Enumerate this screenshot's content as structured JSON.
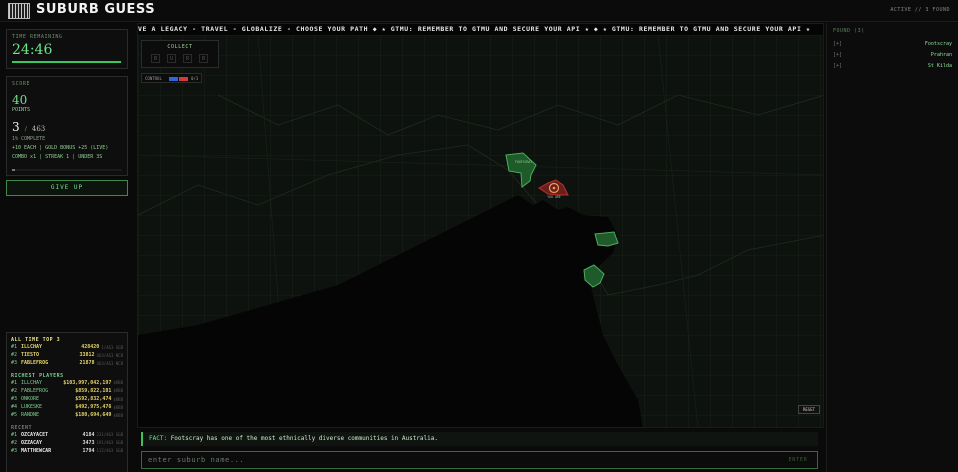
{
  "header": {
    "title": "SUBURB GUESS",
    "status": "ACTIVE // 3 FOUND"
  },
  "timer": {
    "label": "TIME REMAINING",
    "value": "24:46",
    "progress": 0.99
  },
  "score": {
    "label": "SCORE",
    "points": "40",
    "points_label": "POINTS",
    "found": "3",
    "separator": "/",
    "total": "463",
    "complete": "1% COMPLETE",
    "bonus": "+10 EACH | GOLD BONUS +25 (LIVE)",
    "combo": "COMBO x1 | STREAK 1 | UNDER 3S",
    "progress": 0.01
  },
  "give_up_label": "GIVE UP",
  "leaderboards": {
    "all_time": {
      "title": "ALL TIME TOP 3",
      "rows": [
        {
          "rank": "#1",
          "name": "ILLCHAY",
          "score": "428420",
          "extra": "1/463 SGB"
        },
        {
          "rank": "#2",
          "name": "TIESTO",
          "score": "33812",
          "extra": "463/463 NCB"
        },
        {
          "rank": "#3",
          "name": "FABLEFROG",
          "score": "21878",
          "extra": "463/463 NCB"
        }
      ]
    },
    "richest": {
      "title": "RICHEST PLAYERS",
      "rows": [
        {
          "rank": "#1",
          "name": "ILLCHAY",
          "score": "$103,997,042,197",
          "extra": "$RBB"
        },
        {
          "rank": "#2",
          "name": "FABLEFROG",
          "score": "$859,822,101",
          "extra": "$RBB"
        },
        {
          "rank": "#3",
          "name": "ONKORE",
          "score": "$592,832,474",
          "extra": "$RBB"
        },
        {
          "rank": "#4",
          "name": "LUKESKE",
          "score": "$492,975,476",
          "extra": "$RBB"
        },
        {
          "rank": "#5",
          "name": "RANDNE",
          "score": "$180,694,649",
          "extra": "$RBB"
        }
      ]
    },
    "recent": {
      "title": "RECENT",
      "rows": [
        {
          "rank": "#1",
          "name": "OZCAYACET",
          "score": "4184",
          "extra": "231/463 SGB"
        },
        {
          "rank": "#2",
          "name": "OZZACAY",
          "score": "3473",
          "extra": "191/463 SGB"
        },
        {
          "rank": "#3",
          "name": "MATTHEWCAR",
          "score": "1794",
          "extra": "112/463 SGB"
        }
      ]
    }
  },
  "ticker_text": "VE A LEGACY - TRAVEL - GLOBALIZE - CHOOSE YOUR PATH ◆ ★ GTMU: REMEMBER TO GTMU AND SECURE YOUR API ★ ◆ ★ GTMU: REMEMBER TO GTMU AND SECURE YOUR API ★",
  "collect": {
    "label": "COLLECT",
    "slots": [
      "B",
      "U",
      "R",
      "B"
    ]
  },
  "control": {
    "label": "CONTROL",
    "value": "0/3",
    "colors": [
      "#2a69d8",
      "#d13b3b"
    ]
  },
  "reset_label": "RESET",
  "fact": {
    "label": "FACT:",
    "text": "Footscray has one of the most ethnically diverse communities in Australia."
  },
  "guess_input": {
    "placeholder": "enter suburb name...",
    "value": ""
  },
  "enter_label": "ENTER",
  "found_panel": {
    "title": "FOUND (3)",
    "items": [
      {
        "marker": "[+]",
        "name": "Footscray"
      },
      {
        "marker": "[+]",
        "name": "Prahran"
      },
      {
        "marker": "[+]",
        "name": "St Kilda"
      }
    ]
  },
  "colors": {
    "accent": "#6fe38a",
    "found_region": "#2f8a3f",
    "target_region": "#b9302b",
    "background": "#0a0a0a"
  }
}
